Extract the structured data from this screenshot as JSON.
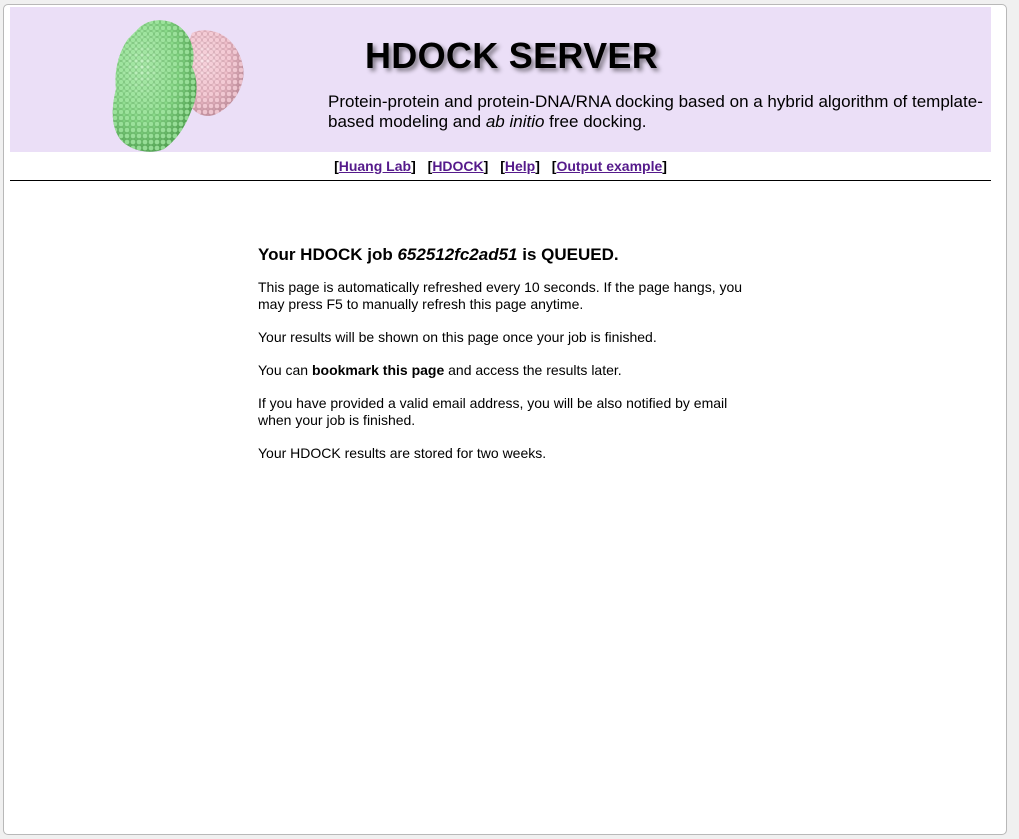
{
  "header": {
    "title": "HDOCK SERVER",
    "tagline_part1": "Protein-protein and protein-DNA/RNA docking based on a hybrid algorithm of template-based modeling and ",
    "tagline_italic": "ab initio",
    "tagline_part2": " free docking.",
    "logo_icon": "protein-complex-logo",
    "colors": {
      "banner_bg": "#ebdff7",
      "protein_green": "#8fe08f",
      "protein_pink": "#f2c4cf"
    }
  },
  "nav": {
    "items": [
      {
        "label": "Huang Lab"
      },
      {
        "label": "HDOCK"
      },
      {
        "label": "Help"
      },
      {
        "label": "Output example"
      }
    ],
    "link_color": "#551a8b"
  },
  "job": {
    "prefix": "Your HDOCK job ",
    "job_id": "652512fc2ad51",
    "status_text": " is QUEUED."
  },
  "messages": {
    "refresh": "This page is automatically refreshed every 10 seconds. If the page hangs, you may press F5 to manually refresh this page anytime.",
    "results": "Your results will be shown on this page once your job is finished.",
    "bookmark_prefix": "You can ",
    "bookmark_bold": "bookmark this page",
    "bookmark_suffix": " and access the results later.",
    "email": "If you have provided a valid email address, you will be also notified by email when your job is finished.",
    "storage": "Your HDOCK results are stored for two weeks."
  }
}
